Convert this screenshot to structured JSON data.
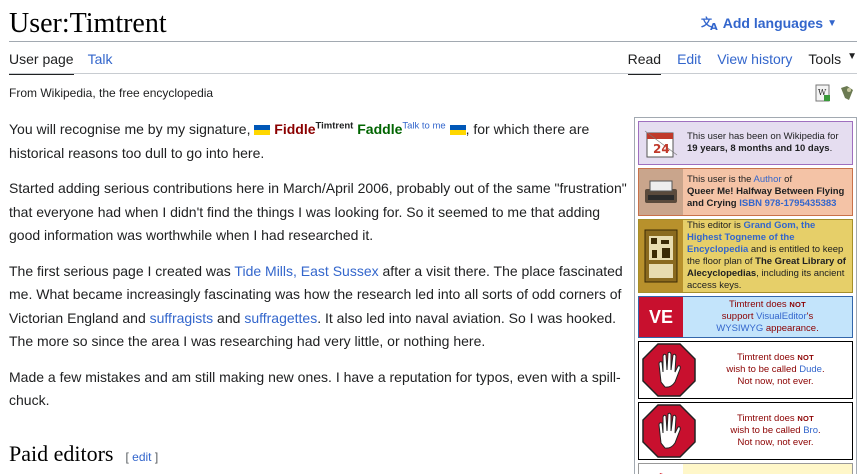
{
  "header": {
    "title": "User:Timtrent",
    "add_languages": "Add languages"
  },
  "tabs_left": [
    "User page",
    "Talk"
  ],
  "tabs_right": [
    "Read",
    "Edit",
    "View history"
  ],
  "tools_label": "Tools",
  "tagline": "From Wikipedia, the free encyclopedia",
  "signature": {
    "fiddle": "Fiddle",
    "fiddle_sup": "Timtrent",
    "faddle": "Faddle",
    "faddle_sup": "Talk to me"
  },
  "paragraphs": {
    "p1_pre": "You will recognise me by my signature, ",
    "p1_post": ", for which there are historical reasons too dull to go into here.",
    "p2": "Started adding serious contributions here in March/April 2006, probably out of the same \"frustration\" that everyone had when I didn't find the things I was looking for. So it seemed to me that adding good information was worthwhile when I had researched it.",
    "p3_a": "The first serious page I created was ",
    "p3_link1": "Tide Mills, East Sussex",
    "p3_b": " after a visit there. The place fascinated me. What became increasingly fascinating was how the research led into all sorts of odd corners of Victorian England and ",
    "p3_link2": "suffragists",
    "p3_c": " and ",
    "p3_link3": "suffragettes",
    "p3_d": ". It also led into naval aviation. So I was hooked. The more so since the area I was researching had very little, or nothing here.",
    "p4": "Made a few mistakes and am still making new ones. I have a reputation for typos, even with a spill-chuck."
  },
  "section": {
    "heading": "Paid editors",
    "edit_open": "[ ",
    "edit_label": "edit",
    "edit_close": " ]"
  },
  "userboxes": {
    "b1": {
      "text_a": "This user has been on Wikipedia for ",
      "text_b": "19 years, 8 months and 10 days",
      "text_c": ".",
      "calendar_day": "24"
    },
    "b2": {
      "text_a": "This user is the ",
      "link": "Author",
      "text_b": " of",
      "book": "Queer Me! Halfway Between Flying and Crying",
      "isbn": "ISBN 978-1795435383"
    },
    "b3": {
      "text_a": "This editor is ",
      "link": "Grand Gom, the Highest Togneme of the Encyclopedia",
      "text_b": " and is entitled to keep the floor plan of ",
      "library": "The Great Library of Alecyclopedias",
      "text_c": ", including its ancient access keys."
    },
    "b4": {
      "logo": "VE",
      "text_a": "Timtrent does ",
      "not": "NOT",
      "text_b": "support ",
      "link": "VisualEditor",
      "text_c": "'s ",
      "link2": "WYSIWYG",
      "text_d": " appearance."
    },
    "b5": {
      "text_a": "Timtrent does ",
      "not": "NOT",
      "text_b": "wish to be called ",
      "name": "Dude",
      "text_c": ".",
      "text_d": "Not now, not ever."
    },
    "b6": {
      "text_a": "Timtrent does ",
      "not": "NOT",
      "text_b": "wish to be called ",
      "name": "Bro",
      "text_c": ".",
      "text_d": "Not now, not ever."
    }
  },
  "colors": {
    "link": "#3366cc",
    "fiddle": "#8b0000",
    "faddle": "#006400",
    "stop_red": "#c8102e"
  }
}
